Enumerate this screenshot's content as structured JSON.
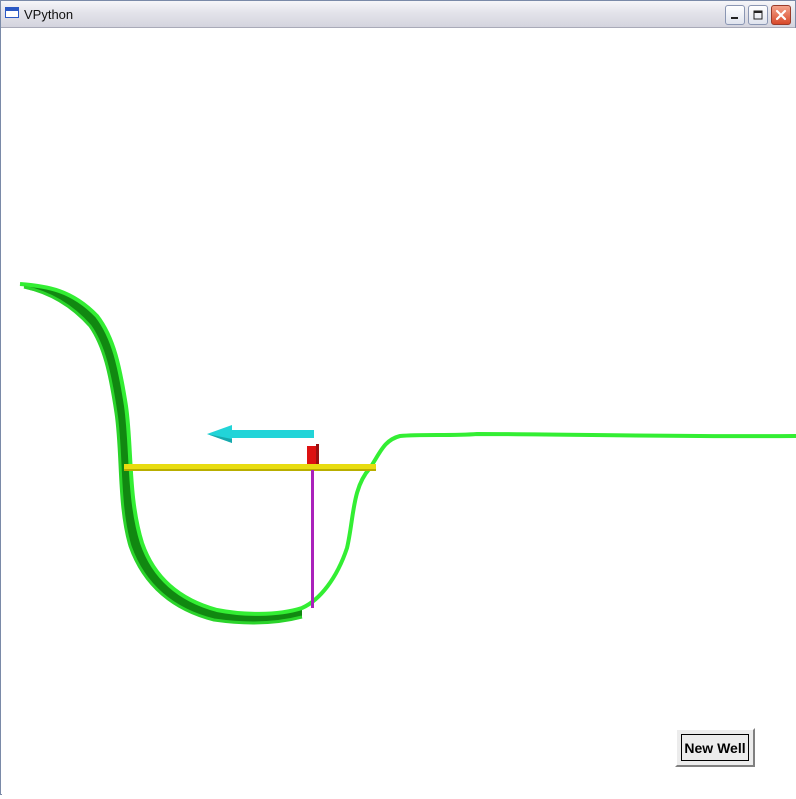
{
  "window": {
    "title": "VPython",
    "icons": {
      "app": "window-icon",
      "minimize": "minimize-icon",
      "maximize": "maximize-icon",
      "close": "close-icon"
    }
  },
  "scene": {
    "colors": {
      "background": "#ffffff",
      "well_front": "#33ee33",
      "well_side": "#118811",
      "water_level": "#e8dc10",
      "water_level_shadow": "#b8ae00",
      "particle": "#dd1111",
      "velocity_arrow": "#22d4d8",
      "probe_line": "#aa22bb"
    },
    "objects": [
      "potential-well-curve",
      "energy-level-bar",
      "particle-block",
      "velocity-arrow",
      "probe-line"
    ]
  },
  "controls": {
    "new_well_label": "New Well"
  }
}
